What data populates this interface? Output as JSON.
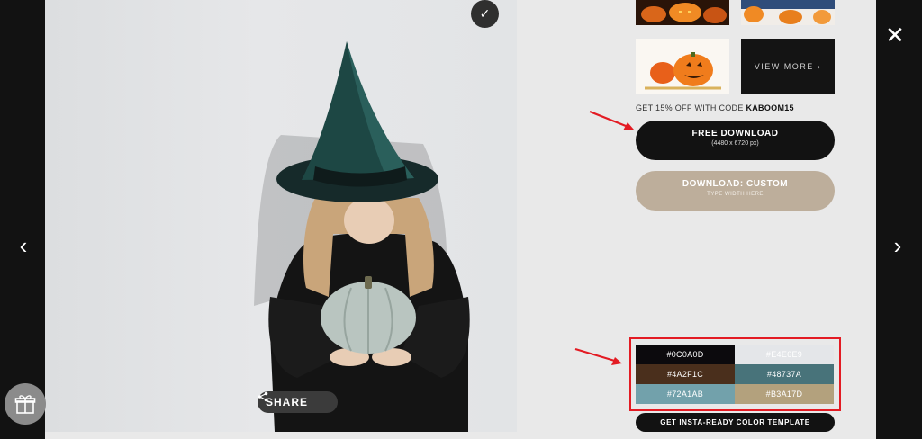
{
  "photo": {
    "alt": "Woman in witch hat holding a pale pumpkin"
  },
  "share": {
    "label": "SHARE"
  },
  "nav": {
    "prev": "‹",
    "next": "›",
    "close": "✕",
    "check": "✓"
  },
  "related": {
    "view_more": "VIEW MORE  ›"
  },
  "promo": {
    "prefix": "GET 15% OFF WITH CODE ",
    "code": "KABOOM15"
  },
  "download": {
    "free_label": "FREE DOWNLOAD",
    "free_size": "(4480 x 6720 px)",
    "custom_label": "DOWNLOAD: CUSTOM",
    "custom_hint": "TYPE WIDTH HERE"
  },
  "palette": {
    "swatches": [
      {
        "hex_label": "#0C0A0D",
        "color": "#0c0a0d"
      },
      {
        "hex_label": "#E4E6E9",
        "color": "#e4e6e9"
      },
      {
        "hex_label": "#4A2F1C",
        "color": "#4a2f1c"
      },
      {
        "hex_label": "#48737A",
        "color": "#48737a"
      },
      {
        "hex_label": "#72A1AB",
        "color": "#72a1ab"
      },
      {
        "hex_label": "#B3A17D",
        "color": "#b3a17d"
      }
    ],
    "cta": "GET INSTA-READY COLOR TEMPLATE"
  },
  "colors": {
    "accent_red": "#e31b23",
    "button_dark": "#121212",
    "button_tan": "#bdae9b",
    "panel_bg": "#e9e9e9"
  }
}
